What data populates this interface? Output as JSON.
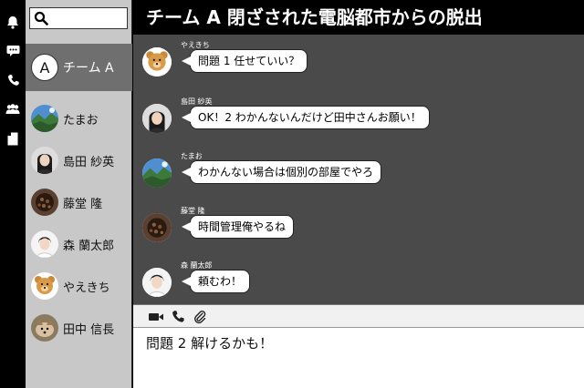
{
  "rail": {
    "icons": [
      "bell-icon",
      "chat-bubble-icon",
      "phone-icon",
      "people-icon",
      "document-icon"
    ]
  },
  "search": {
    "placeholder": ""
  },
  "group": {
    "avatar_letter": "A",
    "name": "チーム A"
  },
  "contacts": [
    {
      "name": "たまお"
    },
    {
      "name": "島田 紗英"
    },
    {
      "name": "藤堂 隆"
    },
    {
      "name": "森 蘭太郎"
    },
    {
      "name": "やえきち"
    },
    {
      "name": "田中 信長"
    }
  ],
  "header": {
    "title": "チーム A  閉ざされた電脳都市からの脱出"
  },
  "messages": [
    {
      "sender": "やえきち",
      "text": "問題 1 任せていい？"
    },
    {
      "sender": "島田 紗英",
      "text": "OK！2 わかんないんだけど田中さんお願い！"
    },
    {
      "sender": "たまお",
      "text": "わかんない場合は個別の部屋でやろ"
    },
    {
      "sender": "藤堂 隆",
      "text": "時間管理俺やるね"
    },
    {
      "sender": "森 蘭太郎",
      "text": "頼むわ！"
    }
  ],
  "toolbar": {
    "icons": [
      "video-camera-icon",
      "phone-icon",
      "paperclip-icon"
    ]
  },
  "compose": {
    "text": "問題 2 解けるかも！"
  },
  "colors": {
    "header_bg": "#000000",
    "chat_bg": "#4a4a4a",
    "sidebar_bg": "#c8c8c8",
    "active_contact_bg": "#6f6f6f"
  }
}
